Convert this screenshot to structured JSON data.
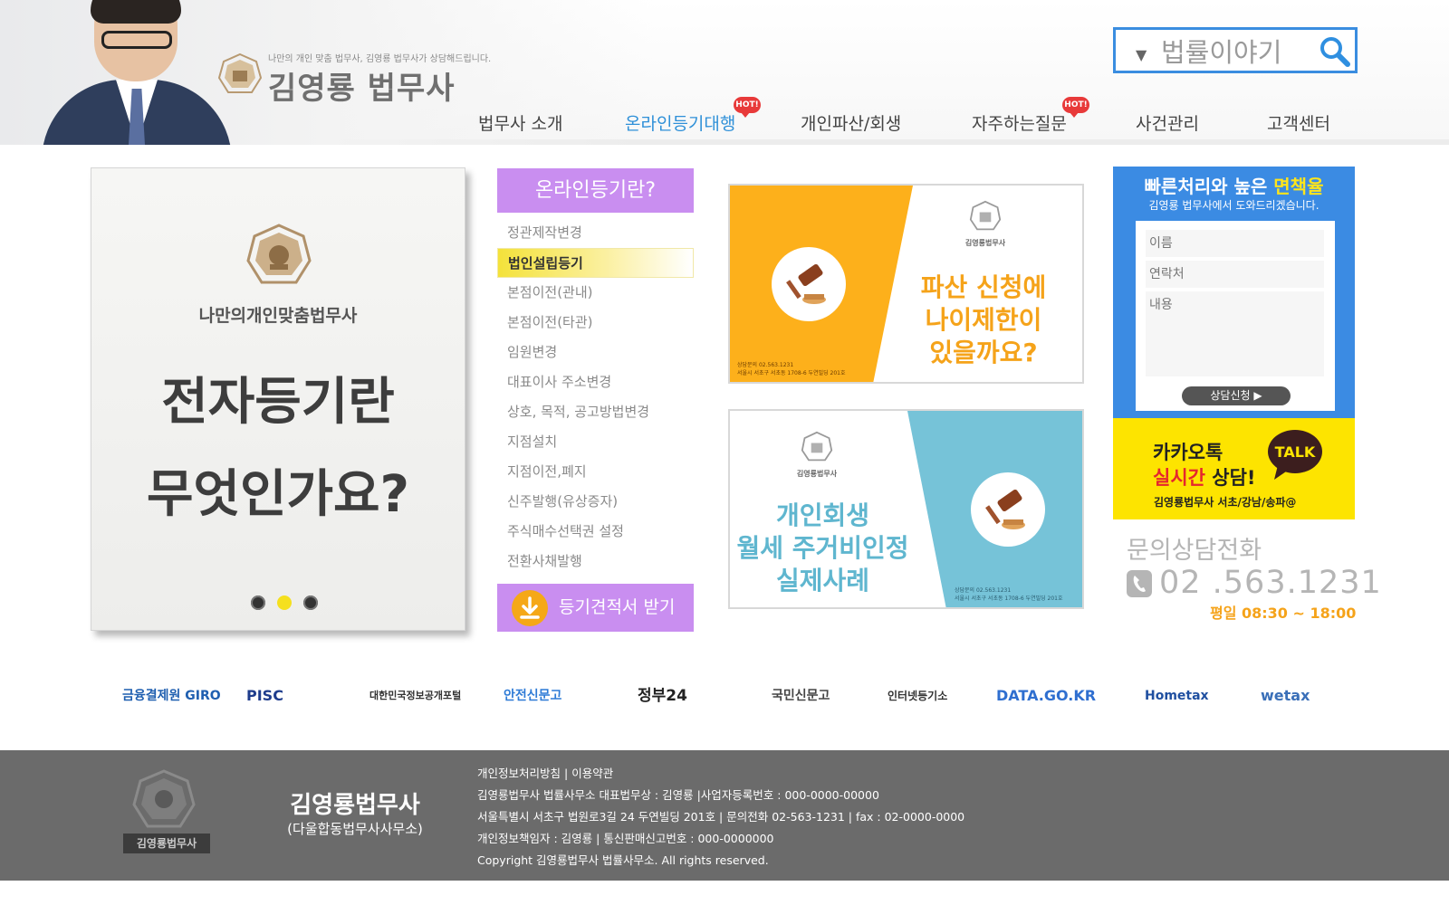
{
  "header": {
    "tagline": "나만의 개인 맞춤 법무사, 김영룡 법무사가 상담해드립니다.",
    "logo_text": "김영룡 법무사",
    "search": {
      "value": "법률이야기"
    },
    "nav": [
      {
        "label": "법무사 소개",
        "hot": false
      },
      {
        "label": "온라인등기대행",
        "hot": true,
        "active": true
      },
      {
        "label": "개인파산/회생",
        "hot": false
      },
      {
        "label": "자주하는질문",
        "hot": true
      },
      {
        "label": "사건관리",
        "hot": false
      },
      {
        "label": "고객센터",
        "hot": false
      }
    ],
    "hot_badge": "HOT!"
  },
  "slider": {
    "subtitle": "나만의개인맞춤법무사",
    "title_line1": "전자등기란",
    "title_line2": "무엇인가요?",
    "dot_count": 3,
    "active_dot": 1
  },
  "registration": {
    "header": "온라인등기란?",
    "items": [
      "정관제작변경",
      "법인설립등기",
      "본점이전(관내)",
      "본점이전(타관)",
      "임원변경",
      "대표이사 주소변경",
      "상호, 목적, 공고방법변경",
      "지점설치",
      "지점이전,폐지",
      "신주발행(유상증자)",
      "주식매수선택권 설정",
      "전환사채발행"
    ],
    "active_item": "법인설립등기",
    "quote_button": "등기견적서 받기"
  },
  "banners": {
    "bankruptcy": {
      "title_lines": [
        "파산 신청에",
        "나이제한이",
        "있을까요?"
      ],
      "logo_caption": "김영룡법무사",
      "contact_lines": [
        "상담문의 02.563.1231",
        "서울시 서초구 서초동 1708-6 두연빌딩 201호"
      ]
    },
    "rehabilitation": {
      "title_lines": [
        "개인회생",
        "월세 주거비인정",
        "실제사례"
      ],
      "logo_caption": "김영룡법무사",
      "contact_lines": [
        "상담문의 02.563.1231",
        "서울시 서초구 서초동 1708-6 두연빌딩 201호"
      ]
    }
  },
  "consult": {
    "headline_prefix": "빠른처리와 높은 ",
    "headline_highlight": "면책율",
    "subheadline": "김영룡 법무사에서 도와드리겠습니다.",
    "name_placeholder": "이름",
    "phone_placeholder": "연락처",
    "message_placeholder": "내용",
    "submit_label": "상담신청 ▶"
  },
  "kakao": {
    "line1": "카카오톡",
    "line2_red": "실시간",
    "line2_rest": " 상담!",
    "line3": "김영룡법무사 서초/강남/송파@",
    "talk_label": "TALK"
  },
  "contact": {
    "title": "문의상담전화",
    "phone": "02 .563.1231",
    "hours": "평일 08:30 ~ 18:00"
  },
  "partners": [
    {
      "label": "금융결제원 GIRO",
      "color": "#1f5fb0"
    },
    {
      "label": "PISC",
      "color": "#1e3c8c"
    },
    {
      "label": "대한민국정보공개포털",
      "color": "#333333"
    },
    {
      "label": "안전신문고",
      "color": "#2e7bd6"
    },
    {
      "label": "정부24",
      "color": "#222222"
    },
    {
      "label": "국민신문고",
      "color": "#444444"
    },
    {
      "label": "인터넷등기소",
      "color": "#333333"
    },
    {
      "label": "DATA.GO.KR",
      "color": "#2f6fd0"
    },
    {
      "label": "Hometax",
      "color": "#1f4fa0"
    },
    {
      "label": "wetax",
      "color": "#3a6fb8"
    }
  ],
  "footer": {
    "seal_caption": "김영룡법무사",
    "name": "김영룡법무사",
    "sub": "(다울합동법무사사무소)",
    "privacy_link": "개인정보처리방침",
    "terms_link": "이용약관",
    "line2": "김영룡법무사 법률사무소  대표법무상 : 김영룡  |사업자등록번호 : 000-0000-00000",
    "line3": "서울특별시 서초구 법원로3길 24 두연빌딩 201호 | 문의전화 02-563-1231 | fax : 02-0000-0000",
    "line4": "개인정보책임자 : 김영룡  | 통신판매신고번호 : 000-0000000",
    "line5": "Copyright 김영룡법무사 법률사무소. All rights reserved."
  }
}
